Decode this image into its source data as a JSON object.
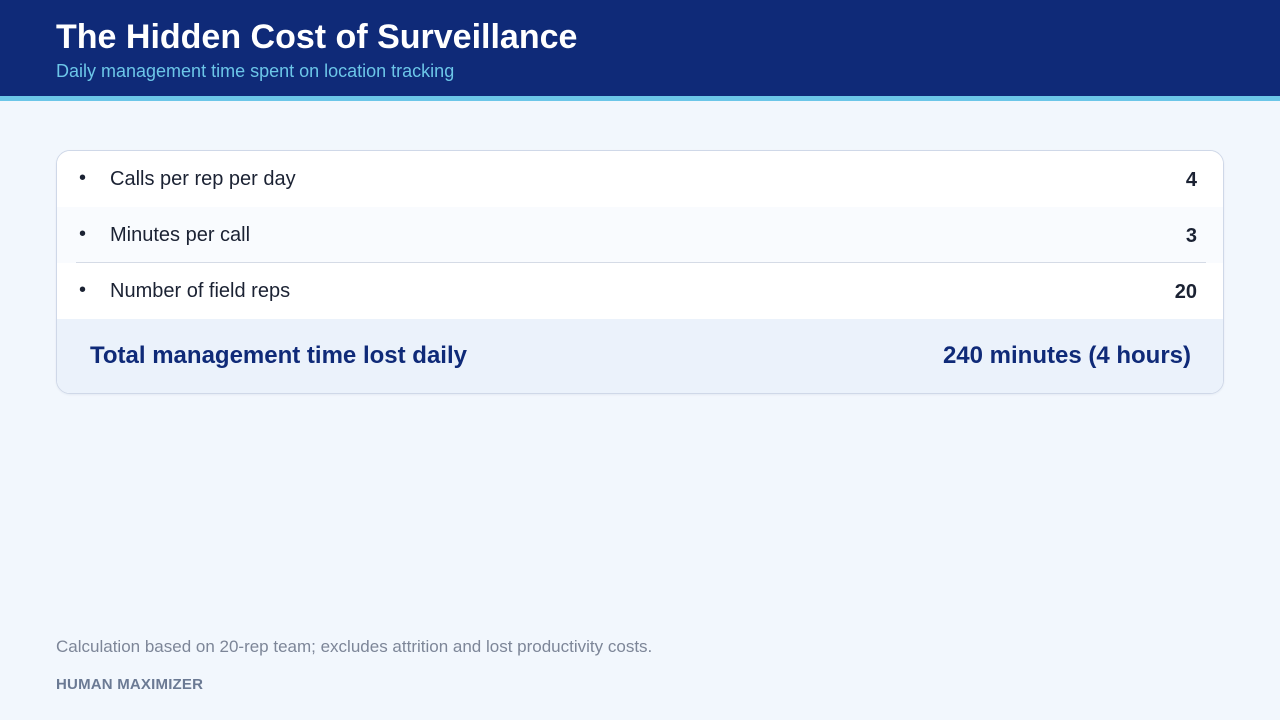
{
  "header": {
    "title": "The Hidden Cost of Surveillance",
    "subtitle": "Daily management time spent on location tracking"
  },
  "rows": [
    {
      "bullet": "•",
      "label": "Calls per rep per day",
      "value": "4"
    },
    {
      "bullet": "•",
      "label": "Minutes per call",
      "value": "3"
    },
    {
      "bullet": "•",
      "label": "Number of field reps",
      "value": "20"
    }
  ],
  "total": {
    "label": "Total management time lost daily",
    "value": "240 minutes (4 hours)"
  },
  "footer": {
    "note": "Calculation based on 20-rep team; excludes attrition and lost productivity costs.",
    "brand": "HUMAN MAXIMIZER"
  },
  "colors": {
    "header_bg": "#0f2a78",
    "accent": "#6cc6e8",
    "page_bg": "#f2f7fd",
    "total_bg": "#ebf2fb"
  }
}
